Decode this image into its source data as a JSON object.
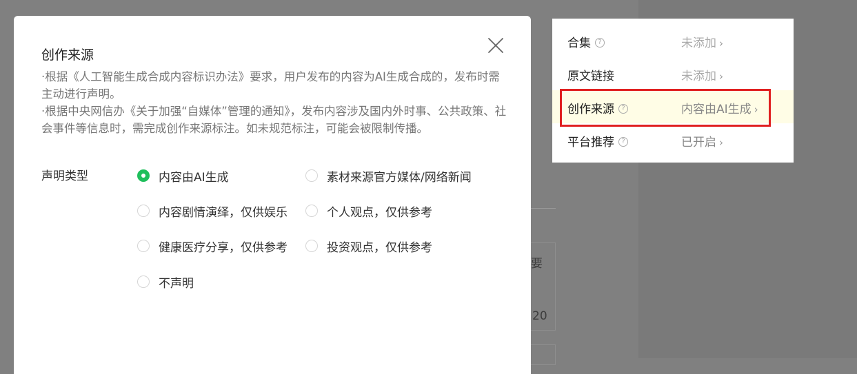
{
  "dialog": {
    "title": "创作来源",
    "desc_1": "·根据《人工智能生成合成内容标识办法》要求，用户发布的内容为AI生成合成的，发布时需主动进行声明。",
    "desc_2": "·根据中央网信办《关于加强“自媒体”管理的通知》，发布内容涉及国内外时事、公共政策、社会事件等信息时，需完成创作来源标注。如未规范标注，可能会被限制传播。",
    "type_label": "声明类型",
    "selected": "内容由AI生成",
    "options": [
      {
        "label": "内容由AI生成",
        "checked": true
      },
      {
        "label": "素材来源官方媒体/网络新闻",
        "checked": false
      },
      {
        "label": "内容剧情演绎，仅供娱乐",
        "checked": false
      },
      {
        "label": "个人观点，仅供参考",
        "checked": false
      },
      {
        "label": "健康医疗分享，仅供参考",
        "checked": false
      },
      {
        "label": "投资观点，仅供参考",
        "checked": false
      },
      {
        "label": "不声明",
        "checked": false
      }
    ]
  },
  "panel": {
    "rows": [
      {
        "label": "合集",
        "has_help": true,
        "value": "未添加"
      },
      {
        "label": "原文链接",
        "has_help": false,
        "value": "未添加"
      },
      {
        "label": "创作来源",
        "has_help": true,
        "value": "内容由AI生成"
      },
      {
        "label": "平台推荐",
        "has_help": true,
        "value": "已开启"
      }
    ],
    "help_glyph": "?",
    "chevron_glyph": "›"
  },
  "background": {
    "text_1": "要",
    "text_2": "20"
  },
  "colors": {
    "radio_checked": "#1fbf5c",
    "highlight_border": "#e02020",
    "highlight_fill": "#fffde6",
    "overlay": "#808080"
  }
}
